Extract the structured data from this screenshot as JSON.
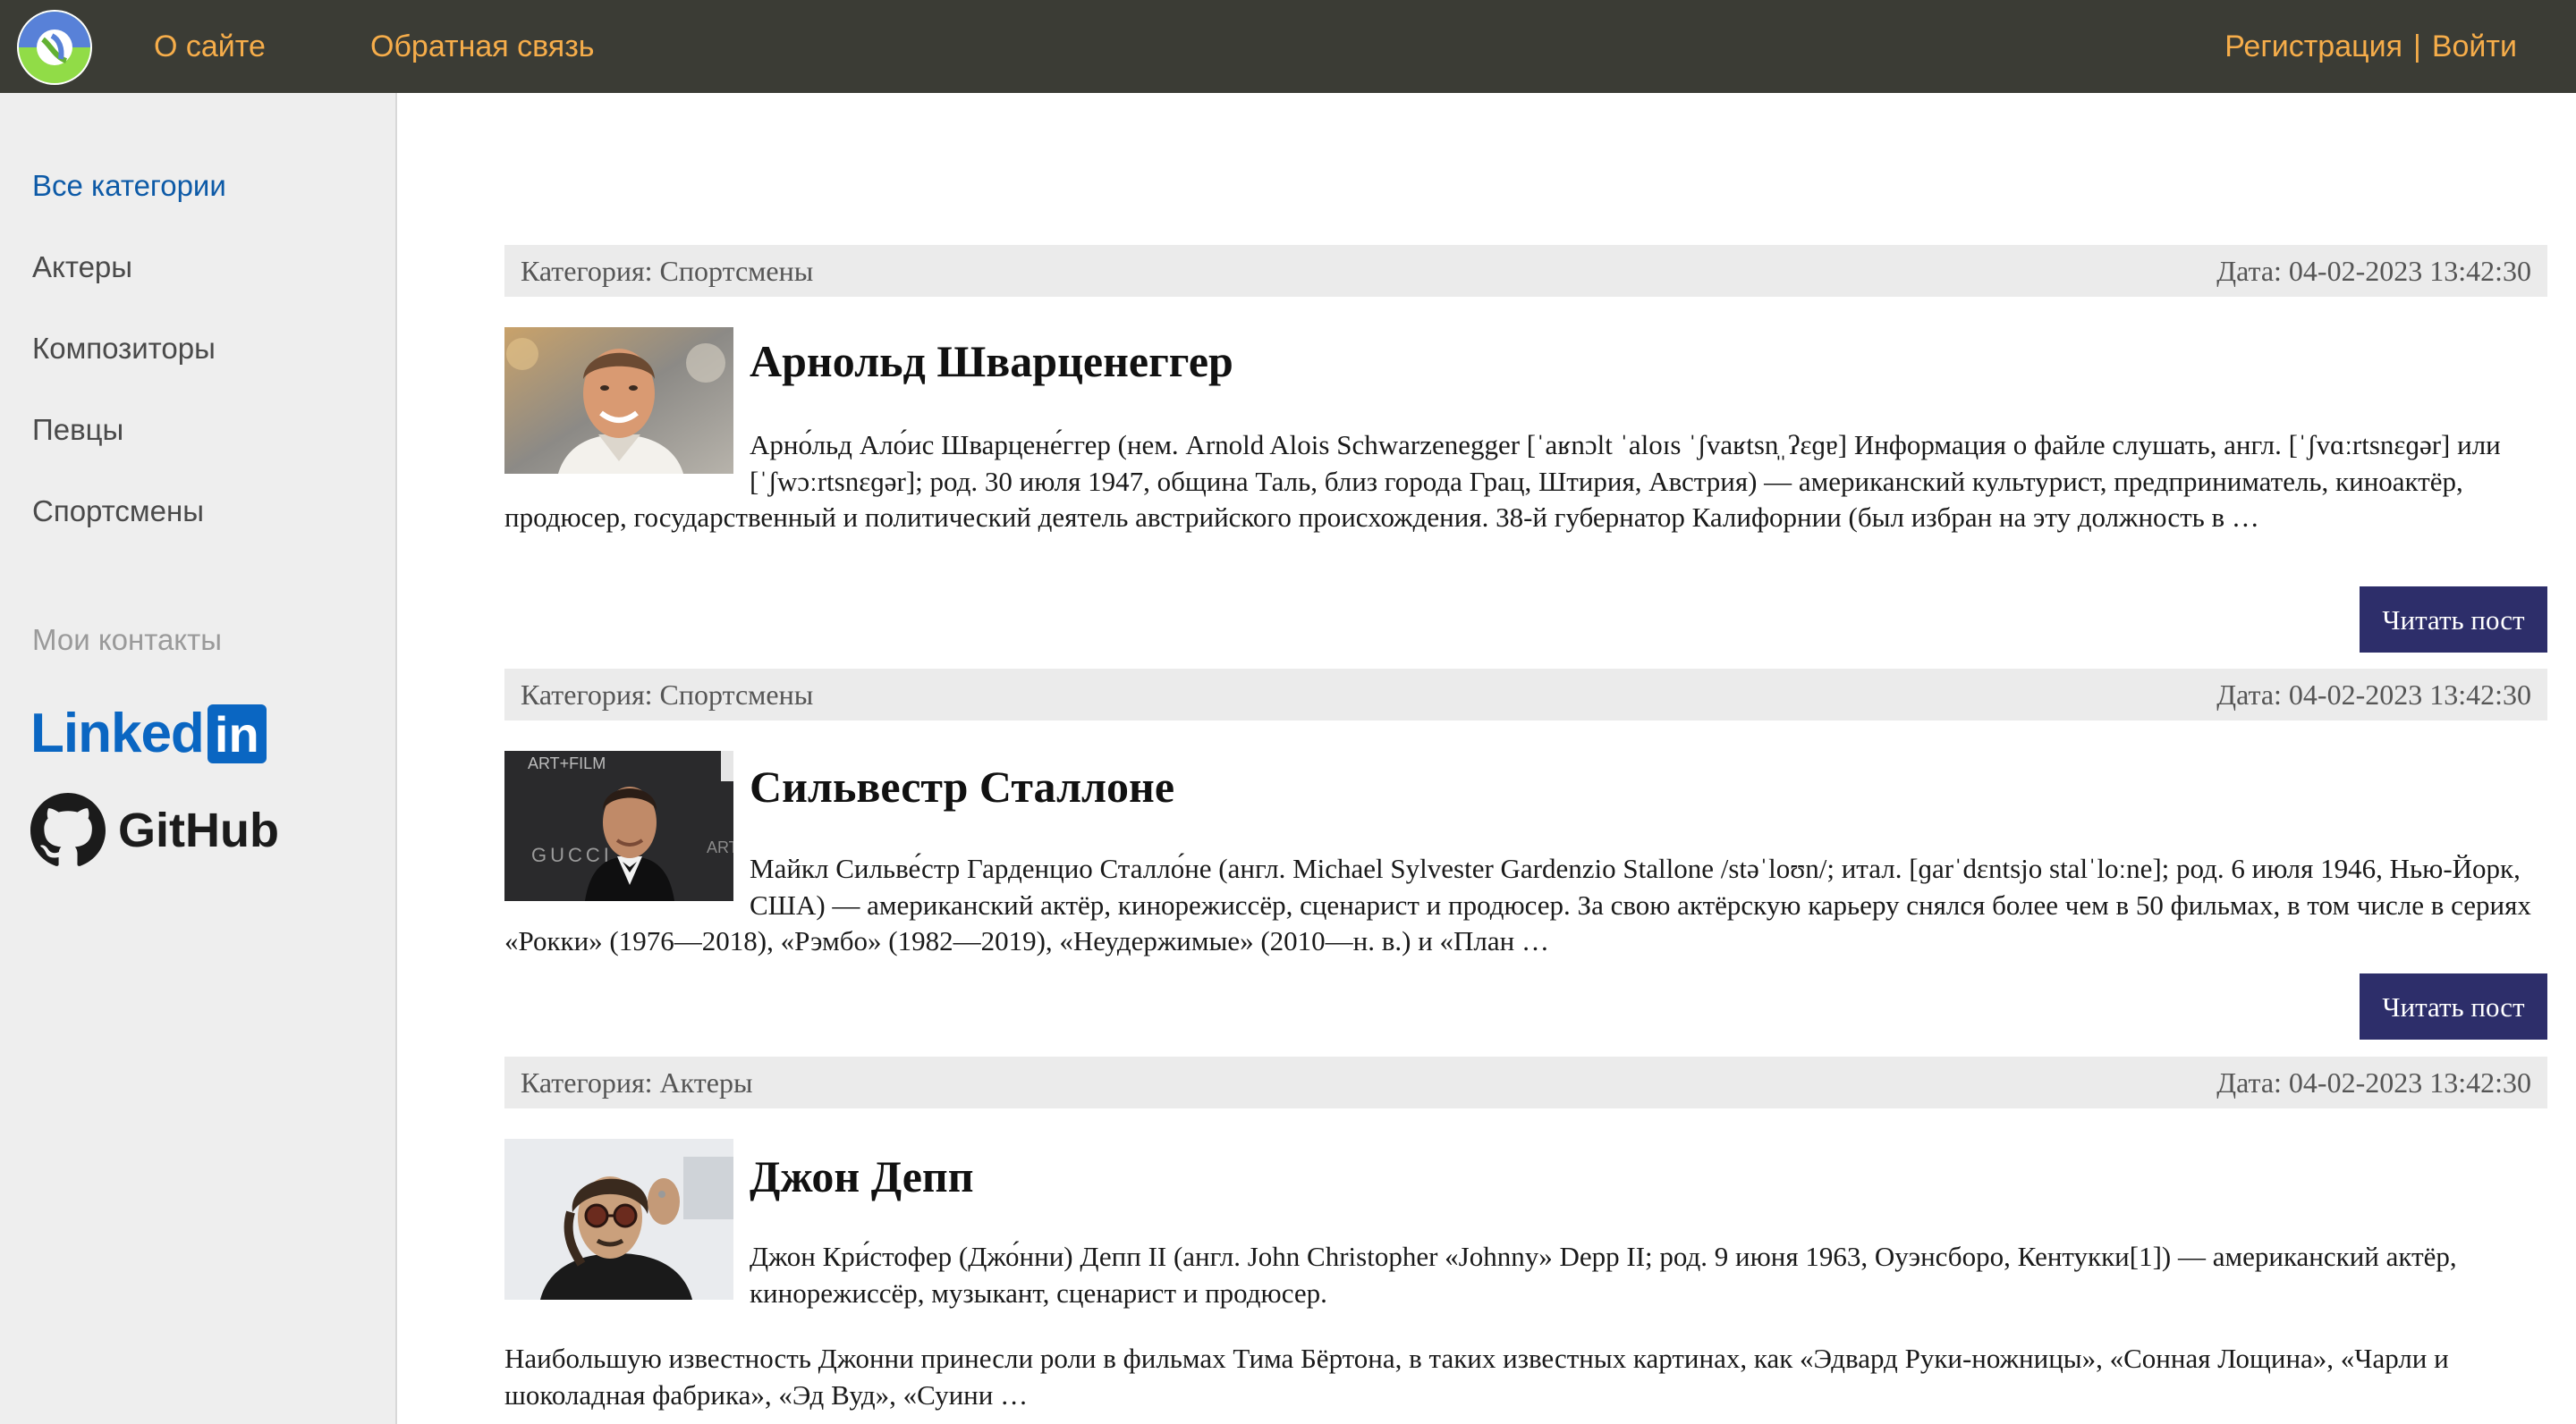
{
  "header": {
    "logo_icon": "clojure-logo-icon",
    "nav_about": "О сайте",
    "nav_feedback": "Обратная связь",
    "nav_register": "Регистрация",
    "nav_separator": "|",
    "nav_login": "Войти",
    "colors": {
      "bar": "#3b3c35",
      "link": "#f6ad4a"
    }
  },
  "sidebar": {
    "categories": [
      {
        "label": "Все категории",
        "active": true
      },
      {
        "label": "Актеры",
        "active": false
      },
      {
        "label": "Композиторы",
        "active": false
      },
      {
        "label": "Певцы",
        "active": false
      },
      {
        "label": "Спортсмены",
        "active": false
      }
    ],
    "contacts_title": "Мои контакты",
    "linkedin": {
      "text": "Linked",
      "box": "in",
      "icon": "linkedin-logo-icon"
    },
    "github": {
      "text": "GitHub",
      "icon": "github-logo-icon"
    }
  },
  "posts": [
    {
      "category": "Категория: Спортсмены",
      "date": "Дата: 04-02-2023 13:42:30",
      "title": "Арнольд Шварценеггер",
      "image_icon": "arnold-portrait-photo",
      "text": "Арно́льд Ало́ис Шварцене́ггер (нем. Arnold Alois Schwarzenegger [ˈaʁnɔlt ˈaloɪs ˈʃvaʁtsn̩ˌʔɛɡɐ] Информация о файле слушать, англ. [ˈʃvɑːrtsnɛɡər] или [ˈʃwɔːrtsnɛɡər]; род. 30 июля 1947, община Таль, близ города Грац, Штирия, Австрия) — американский культурист, предприниматель, киноактёр, продюсер, государственный и политический деятель австрийского происхождения. 38-й губернатор Калифорнии (был избран на эту должность в …",
      "button": "Читать пост"
    },
    {
      "category": "Категория: Спортсмены",
      "date": "Дата: 04-02-2023 13:42:30",
      "title": "Сильвестр Сталлоне",
      "image_icon": "stallone-portrait-photo",
      "image_bg_text_1": "ART+FILM",
      "image_bg_text_2": "GUCCI",
      "image_bg_text_3": "ART",
      "text": "Майкл Сильве́стр Гарденцио Сталло́не (англ. Michael Sylvester Gardenzio Stallone /stəˈloʊn/; итал. [ɡarˈdɛntsjo stalˈloːne]; род. 6 июля 1946, Нью-Йорк, США) — американский актёр, кинорежиссёр, сценарист и продюсер. За свою актёрскую карьеру снялся более чем в 50 фильмах, в том числе в сериях «Рокки» (1976—2018), «Рэмбо» (1982—2019), «Неудержимые» (2010—н. в.) и «План …",
      "button": "Читать пост"
    },
    {
      "category": "Категория: Актеры",
      "date": "Дата: 04-02-2023 13:42:30",
      "title": "Джон Депп",
      "image_icon": "depp-portrait-photo",
      "text": "Джон Кри́стофер (Джо́нни) Депп II (англ. John Christopher «Johnny» Depp II; род. 9 июня 1963, Оуэнсборо, Кентукки[1]) — американский актёр, кинорежиссёр, музыкант, сценарист и продюсер.",
      "text2": "Наибольшую известность Джонни принесли роли в фильмах Тима Бёртона, в таких известных картинах, как «Эдвард Руки-ножницы», «Сонная Лощина», «Чарли и шоколадная фабрика», «Эд Вуд», «Суини …"
    }
  ]
}
